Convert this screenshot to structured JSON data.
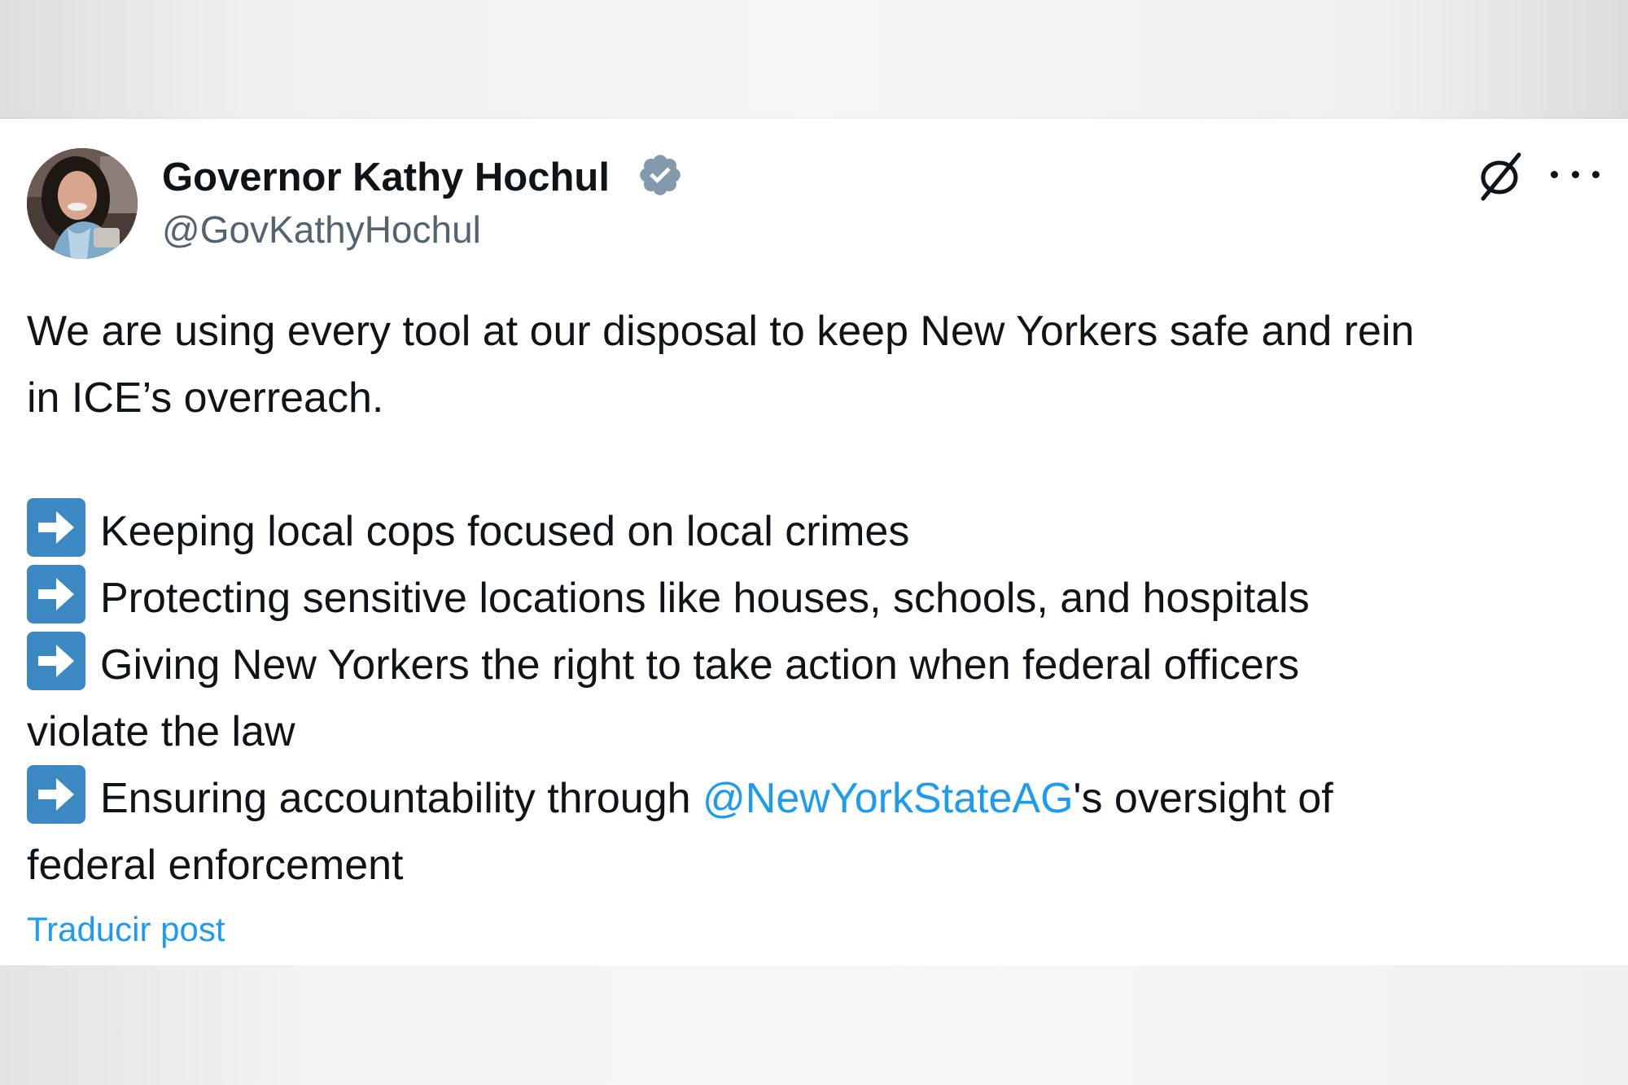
{
  "post": {
    "author": {
      "display_name": "Governor Kathy Hochul",
      "handle": "@GovKathyHochul",
      "verified": true
    },
    "body": {
      "intro_line1": "We are using every tool at our disposal to keep New Yorkers safe and rein",
      "intro_line2": "in ICE’s overreach.",
      "bullets": [
        {
          "line1": "Keeping local cops focused on local crimes"
        },
        {
          "line1": "Protecting sensitive locations like houses, schools, and hospitals"
        },
        {
          "line1": "Giving New Yorkers the right to take action when federal officers",
          "line2": "violate the law"
        },
        {
          "line1_before": "Ensuring accountability through ",
          "mention": "@NewYorkStateAG",
          "line1_after": "'s oversight of",
          "line2": "federal enforcement"
        }
      ]
    },
    "translate_label": "Traducir post"
  },
  "icons": {
    "verified": "verified-badge-icon",
    "grok": "grok-icon",
    "more": "more-icon",
    "bullet": "right-arrow-emoji-icon"
  },
  "colors": {
    "link": "#1d9bf0",
    "text": "#0f1419",
    "secondary": "#536471",
    "verified_badge": "#829aab",
    "bullet_bg": "#3b88c3"
  }
}
